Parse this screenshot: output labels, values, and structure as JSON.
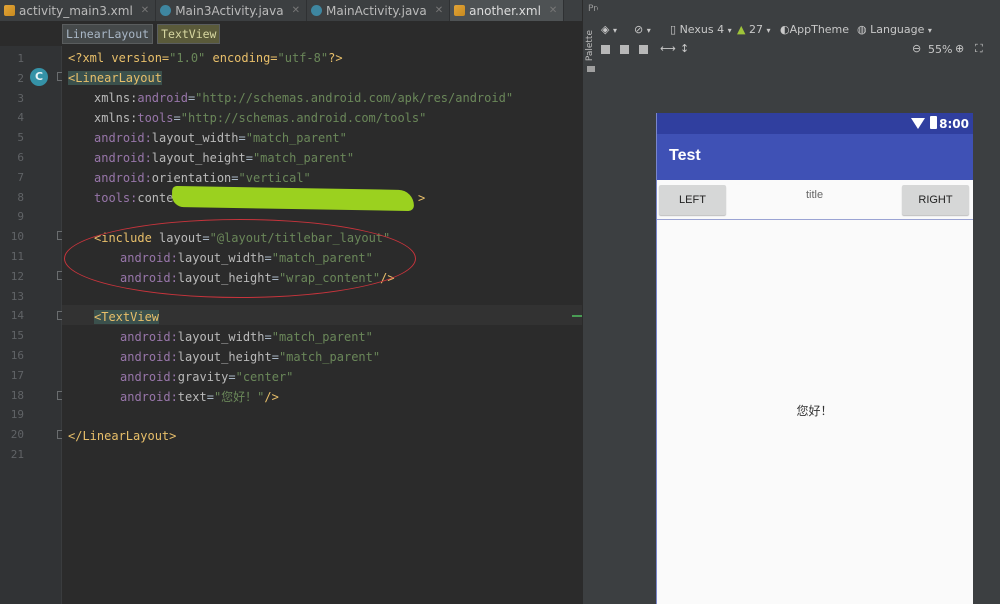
{
  "tabs": [
    {
      "label": "activity_main3.xml",
      "kind": "xml",
      "active": false
    },
    {
      "label": "Main3Activity.java",
      "kind": "java",
      "active": false
    },
    {
      "label": "MainActivity.java",
      "kind": "java",
      "active": false
    },
    {
      "label": "another.xml",
      "kind": "xml",
      "active": true
    }
  ],
  "breadcrumb": [
    "LinearLayout",
    "TextView"
  ],
  "gutter": {
    "line_numbers": [
      "1",
      "2",
      "3",
      "4",
      "5",
      "6",
      "7",
      "8",
      "9",
      "10",
      "11",
      "12",
      "13",
      "14",
      "15",
      "16",
      "17",
      "18",
      "19",
      "20",
      "21"
    ],
    "context_badge": "C"
  },
  "code": {
    "l1": {
      "a": "<?xml version=",
      "b": "\"1.0\"",
      "c": " encoding=",
      "d": "\"utf-8\"",
      "e": "?>"
    },
    "l2": {
      "a": "<LinearLayout"
    },
    "l3": {
      "ns": "xmlns:",
      "attr": "android",
      "eq": "=",
      "val": "\"http://schemas.android.com/apk/res/android\""
    },
    "l4": {
      "ns": "xmlns:",
      "attr": "tools",
      "eq": "=",
      "val": "\"http://schemas.android.com/tools\""
    },
    "l5": {
      "ns": "android:",
      "attr": "layout_width",
      "eq": "=",
      "val": "\"match_parent\""
    },
    "l6": {
      "ns": "android:",
      "attr": "layout_height",
      "eq": "=",
      "val": "\"match_parent\""
    },
    "l7": {
      "ns": "android:",
      "attr": "orientation",
      "eq": "=",
      "val": "\"vertical\""
    },
    "l8": {
      "ns": "tools:",
      "attr": "contex",
      "end": ">"
    },
    "l10": {
      "tag": "<include ",
      "attr": "layout",
      "eq": "=",
      "val": "\"@layout/titlebar_layout\""
    },
    "l11": {
      "ns": "android:",
      "attr": "layout_width",
      "eq": "=",
      "val": "\"match_parent\""
    },
    "l12": {
      "ns": "android:",
      "attr": "layout_height",
      "eq": "=",
      "val": "\"wrap_content\"",
      "end": "/>"
    },
    "l14": {
      "tag": "<TextView"
    },
    "l15": {
      "ns": "android:",
      "attr": "layout_width",
      "eq": "=",
      "val": "\"match_parent\""
    },
    "l16": {
      "ns": "android:",
      "attr": "layout_height",
      "eq": "=",
      "val": "\"match_parent\""
    },
    "l17": {
      "ns": "android:",
      "attr": "gravity",
      "eq": "=",
      "val": "\"center\""
    },
    "l18": {
      "ns": "android:",
      "attr": "text",
      "eq": "=",
      "val": "\"您好！\"",
      "end": "/>"
    },
    "l20": {
      "tag": "</LinearLayout>"
    }
  },
  "side_strip": {
    "palette": "Palette"
  },
  "preview": {
    "panel_title": "Preview",
    "toolbar": {
      "device": "Nexus 4",
      "api": "27",
      "theme": "AppTheme",
      "language": "Language",
      "zoom": "55%"
    },
    "phone": {
      "clock": "8:00",
      "app_title": "Test",
      "left_button": "LEFT",
      "right_button": "RIGHT",
      "titlebar_title": "title",
      "center_text": "您好！"
    }
  },
  "colors": {
    "editor_bg": "#2b2b2b",
    "tag": "#e8bf6a",
    "namespace": "#9876aa",
    "string": "#6a8759",
    "app_bar": "#3f51b5",
    "status_bar": "#303f9f",
    "annotation_ellipse": "#c8343c",
    "redaction_scribble": "#9bd11f"
  }
}
